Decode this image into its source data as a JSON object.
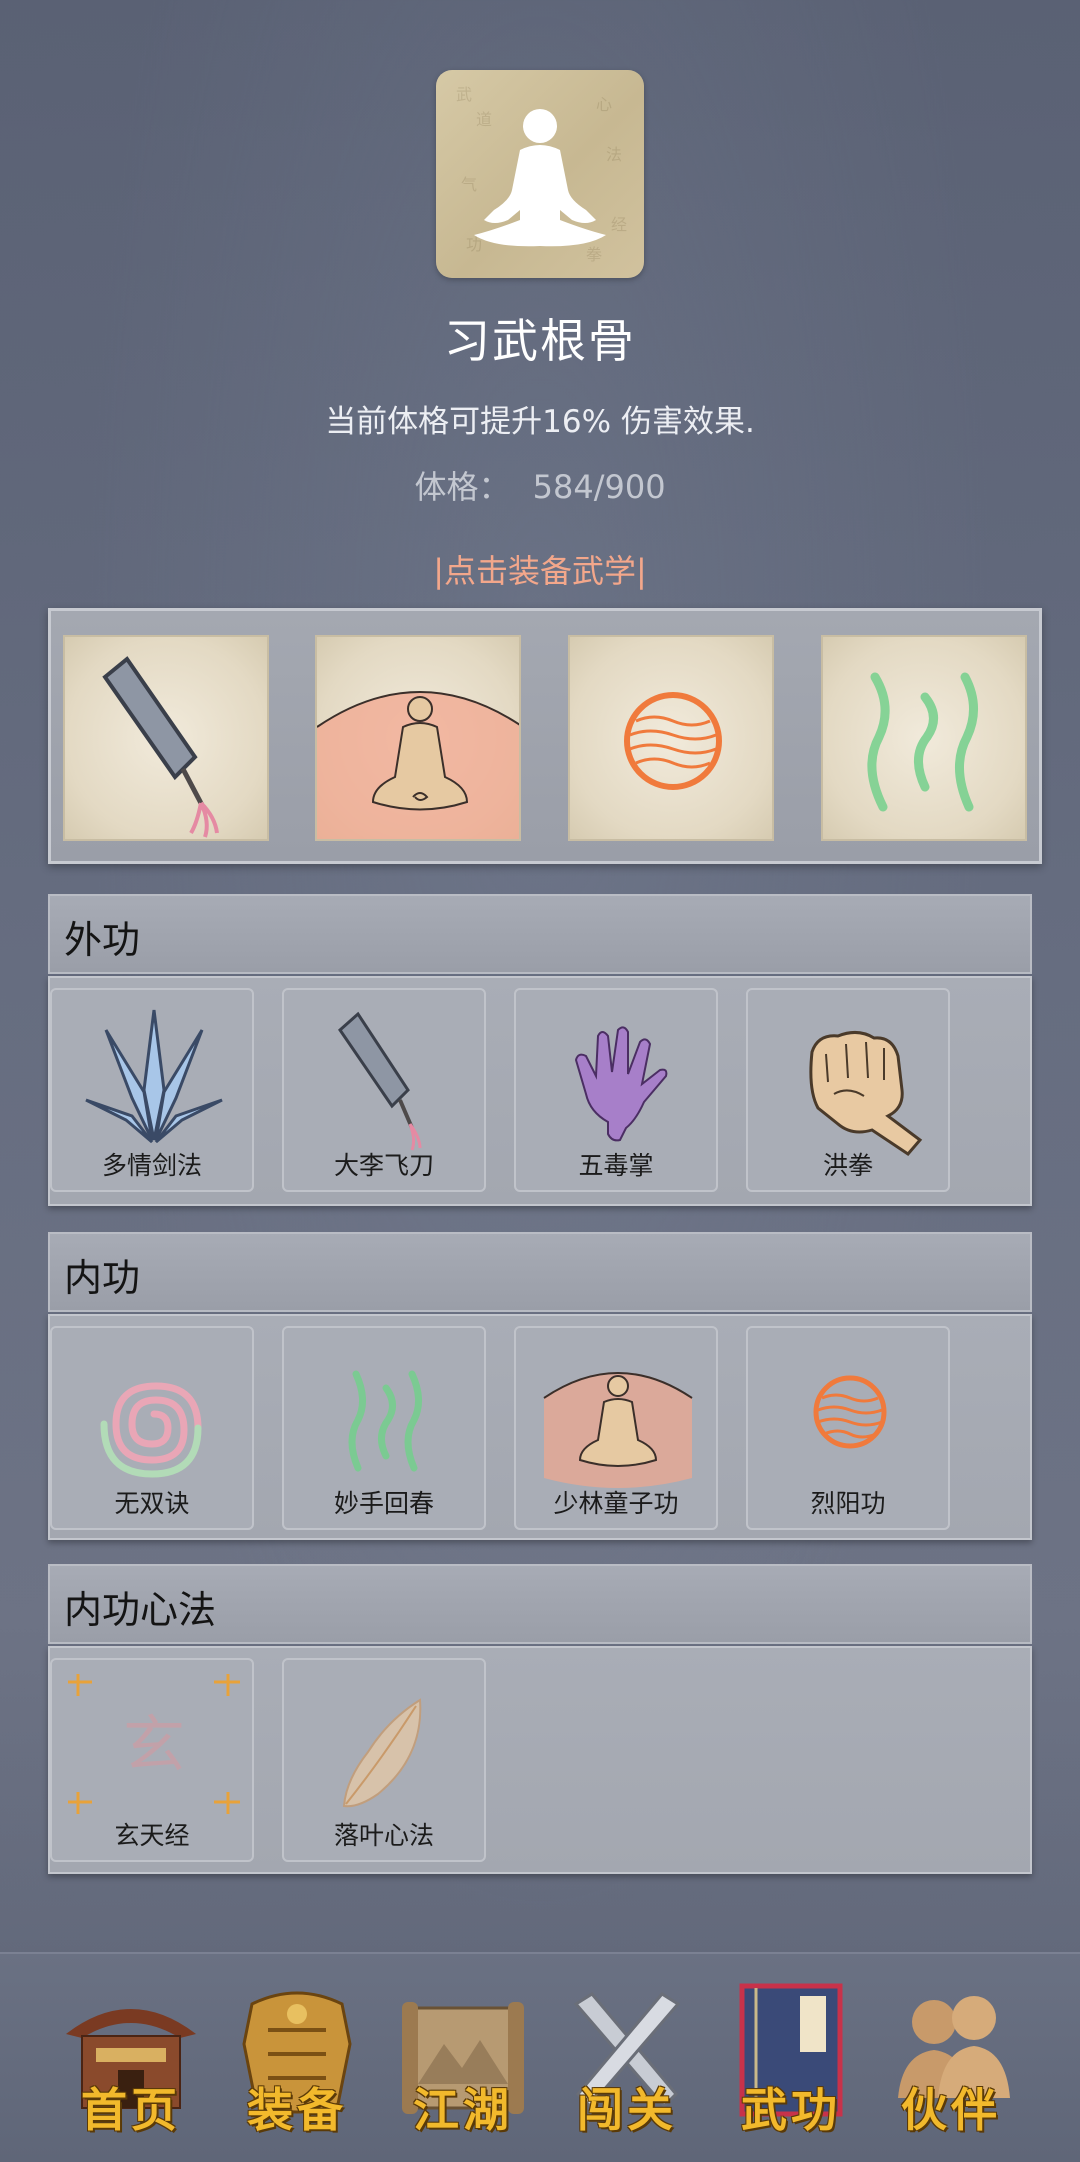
{
  "header": {
    "title": "习武根骨",
    "description": "当前体格可提升16% 伤害效果.",
    "stat_label": "体格：",
    "stat_value": "584/900",
    "equip_link": "|点击装备武学|"
  },
  "equipped_slots": [
    {
      "icon": "flying-knife-icon"
    },
    {
      "icon": "meditation-aura-icon"
    },
    {
      "icon": "fire-orb-icon"
    },
    {
      "icon": "green-qi-icon"
    }
  ],
  "sections": [
    {
      "title": "外功",
      "skills": [
        {
          "label": "多情剑法",
          "icon": "swords-fan-icon"
        },
        {
          "label": "大李飞刀",
          "icon": "flying-knife-icon"
        },
        {
          "label": "五毒掌",
          "icon": "purple-palm-icon"
        },
        {
          "label": "洪拳",
          "icon": "fist-icon"
        }
      ]
    },
    {
      "title": "内功",
      "skills": [
        {
          "label": "无双诀",
          "icon": "spiral-icon"
        },
        {
          "label": "妙手回春",
          "icon": "green-qi-icon"
        },
        {
          "label": "少林童子功",
          "icon": "meditation-aura-icon"
        },
        {
          "label": "烈阳功",
          "icon": "fire-orb-icon"
        }
      ]
    },
    {
      "title": "内功心法",
      "skills": [
        {
          "label": "玄天经",
          "icon": "xuan-scroll-icon",
          "glyph": "玄"
        },
        {
          "label": "落叶心法",
          "icon": "leaf-icon"
        }
      ]
    }
  ],
  "nav": [
    {
      "label": "首页",
      "icon": "temple-icon"
    },
    {
      "label": "装备",
      "icon": "armor-icon"
    },
    {
      "label": "江湖",
      "icon": "scroll-map-icon"
    },
    {
      "label": "闯关",
      "icon": "crossed-swords-icon"
    },
    {
      "label": "武功",
      "icon": "manual-book-icon"
    },
    {
      "label": "伙伴",
      "icon": "companions-icon"
    }
  ],
  "colors": {
    "background": "#636a7c",
    "link": "#f3a78b",
    "nav_text": "#f2b92c"
  }
}
